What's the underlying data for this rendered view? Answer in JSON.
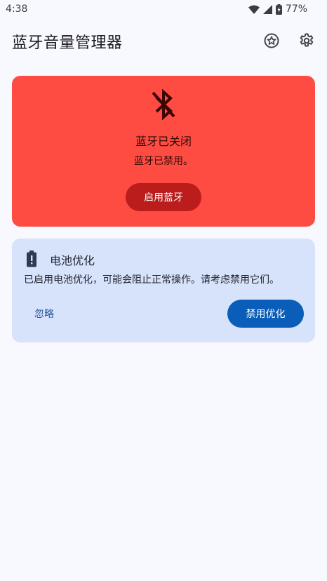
{
  "status_bar": {
    "time": "4:38",
    "battery_percent": "77%",
    "icons": [
      "wifi-icon",
      "cellular-signal-icon",
      "battery-charging-icon"
    ]
  },
  "app_bar": {
    "title": "蓝牙音量管理器",
    "actions": [
      "star-badge-icon",
      "settings-gear-icon"
    ]
  },
  "bluetooth_card": {
    "icon": "bluetooth-disabled-icon",
    "title": "蓝牙已关闭",
    "subtitle": "蓝牙已禁用。",
    "button_label": "启用蓝牙",
    "background_color": "#ff4c42",
    "button_color": "#bb1c1c"
  },
  "battery_card": {
    "icon": "battery-icon",
    "title": "电池优化",
    "body": "已启用电池优化，可能会阻止正常操作。请考虑禁用它们。",
    "ignore_label": "忽略",
    "disable_label": "禁用优化",
    "background_color": "#d7e2fb",
    "button_color": "#0a5db8"
  }
}
